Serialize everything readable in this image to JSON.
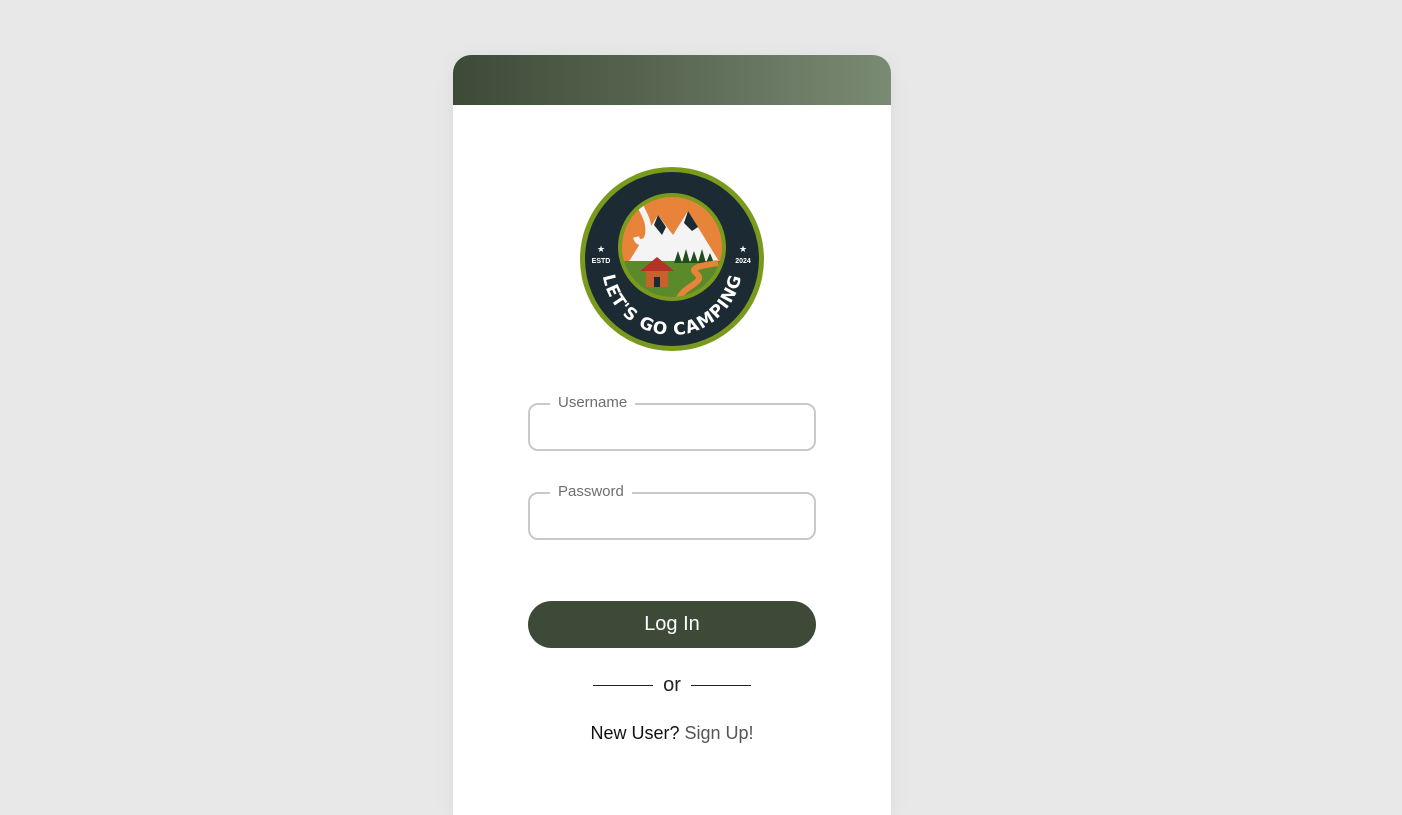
{
  "logo": {
    "text": "LET'S GO CAMPING",
    "estd_label": "ESTD",
    "year": "2024"
  },
  "form": {
    "username": {
      "label": "Username",
      "value": ""
    },
    "password": {
      "label": "Password",
      "value": ""
    },
    "login_label": "Log In",
    "divider_text": "or",
    "new_user_text": "New User?",
    "signup_link": "Sign Up!"
  },
  "colors": {
    "background": "#e8e8e8",
    "brand_dark_green": "#3d4a38",
    "header_gradient_end": "#7a8b74",
    "logo_navy": "#1c2b33",
    "logo_green_ring": "#7a9a1e",
    "logo_orange": "#e8833a"
  }
}
